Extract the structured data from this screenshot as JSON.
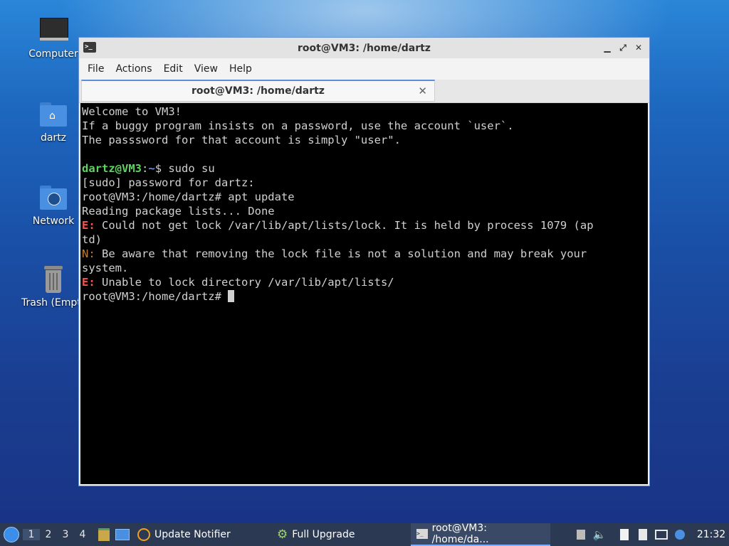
{
  "desktop": {
    "icons": [
      {
        "label": "Computer"
      },
      {
        "label": "dartz"
      },
      {
        "label": "Network"
      },
      {
        "label": "Trash (Empty)"
      }
    ]
  },
  "window": {
    "title": "root@VM3: /home/dartz",
    "menu": [
      "File",
      "Actions",
      "Edit",
      "View",
      "Help"
    ],
    "tab_label": "root@VM3: /home/dartz",
    "buttons": {
      "minimize": "▁",
      "maximize": "⤢",
      "close": "✕"
    }
  },
  "terminal": {
    "welcome": "Welcome to VM3!",
    "info1": "If a buggy program insists on a password, use the account `user`.",
    "info2": "The passsword for that account is simply \"user\".",
    "prompt_user": "dartz@VM3",
    "prompt_sep": ":",
    "prompt_path": "~",
    "prompt_cmd": "$ sudo su",
    "sudo_prompt": "[sudo] password for dartz:",
    "root_cmd": "root@VM3:/home/dartz# apt update",
    "reading": "Reading package lists... Done",
    "e1_tag": "E:",
    "e1_text": " Could not get lock /var/lib/apt/lists/lock. It is held by process 1079 (ap",
    "e1_wrap": "td)",
    "n_tag": "N:",
    "n_text": " Be aware that removing the lock file is not a solution and may break your",
    "n_wrap": "system.",
    "e2_tag": "E:",
    "e2_text": " Unable to lock directory /var/lib/apt/lists/",
    "final_prompt": "root@VM3:/home/dartz# "
  },
  "taskbar": {
    "workspaces": [
      "1",
      "2",
      "3",
      "4"
    ],
    "tasks": [
      {
        "label": "Update Notifier"
      },
      {
        "label": "Full Upgrade"
      },
      {
        "label": "root@VM3: /home/da..."
      }
    ],
    "clock": "21:32"
  },
  "colors": {
    "error": "#ff5050",
    "note": "#c07a3a",
    "prompt_user": "#5fd35f",
    "prompt_path": "#6e8ff0"
  }
}
